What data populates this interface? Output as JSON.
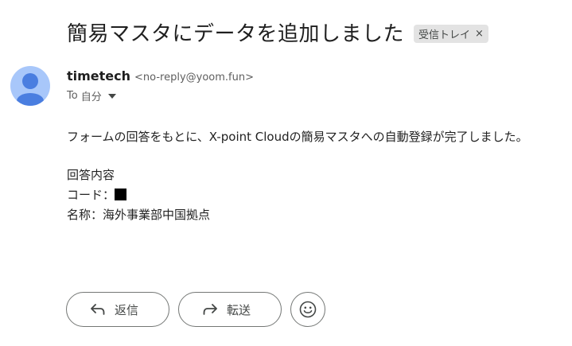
{
  "subject": {
    "title": "簡易マスタにデータを追加しました",
    "label_chip": "受信トレイ",
    "label_chip_remove": "×"
  },
  "sender": {
    "name": "timetech",
    "email": "<no-reply@yoom.fun>",
    "to_prefix": "To",
    "to_recipient": "自分",
    "avatar_icon": "person-icon",
    "avatar_color": "#a8c7fa"
  },
  "body": {
    "line1": "フォームの回答をもとに、X-point Cloudの簡易マスタへの自動登録が完了しました。",
    "line2": "回答内容",
    "code_label": "コード：",
    "name_line": "名称：海外事業部中国拠点"
  },
  "actions": {
    "reply_label": "返信",
    "forward_label": "転送",
    "reply_icon": "reply-arrow-icon",
    "forward_icon": "forward-arrow-icon",
    "emoji_icon": "smiley-icon"
  }
}
